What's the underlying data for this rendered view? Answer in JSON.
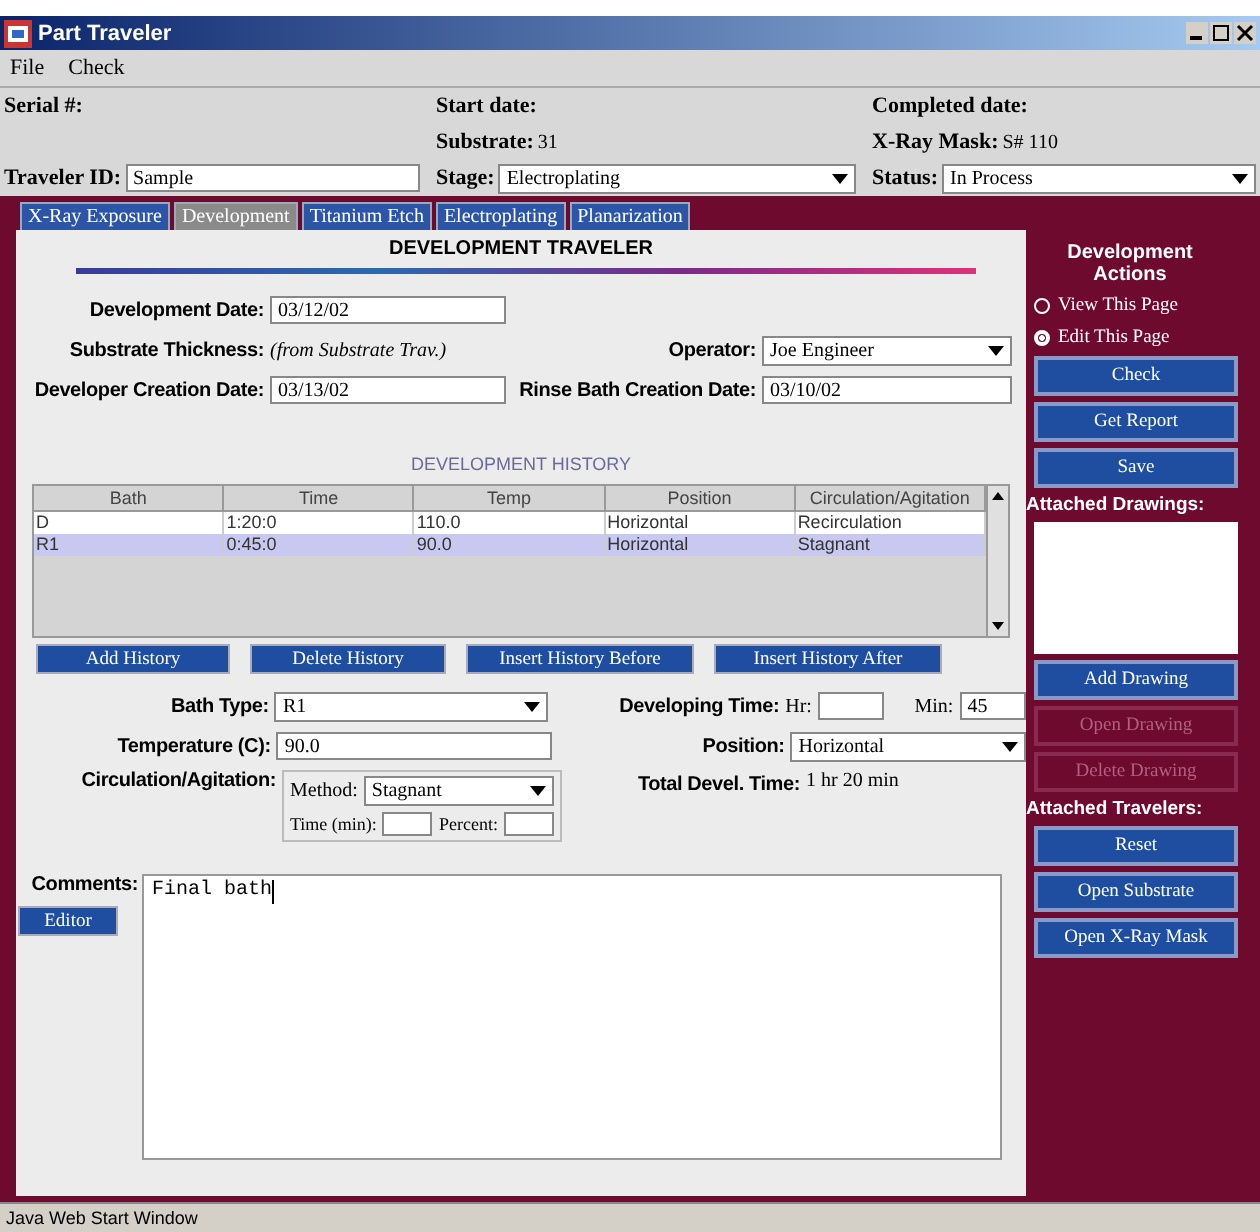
{
  "window": {
    "title": "Part Traveler"
  },
  "menu": [
    "File",
    "Check"
  ],
  "header": {
    "serial": {
      "label": "Serial #:"
    },
    "start_date": {
      "label": "Start date:"
    },
    "completed_date": {
      "label": "Completed date:"
    },
    "substrate": {
      "label": "Substrate:",
      "value": "31"
    },
    "xray_mask": {
      "label": "X-Ray Mask:",
      "value": "S# 110"
    },
    "traveler_id": {
      "label": "Traveler ID:",
      "value": "Sample"
    },
    "stage": {
      "label": "Stage:",
      "value": "Electroplating"
    },
    "status": {
      "label": "Status:",
      "value": "In Process"
    }
  },
  "tabs": [
    {
      "label": "X-Ray Exposure",
      "selected": false
    },
    {
      "label": "Development",
      "selected": true
    },
    {
      "label": "Titanium Etch",
      "selected": false
    },
    {
      "label": "Electroplating",
      "selected": false
    },
    {
      "label": "Planarization",
      "selected": false
    }
  ],
  "form": {
    "title": "DEVELOPMENT TRAVELER",
    "development_date": {
      "label": "Development Date:",
      "value": "03/12/02"
    },
    "substrate_thickness": {
      "label": "Substrate Thickness:",
      "value": "(from Substrate Trav.)"
    },
    "operator": {
      "label": "Operator:",
      "value": "Joe Engineer"
    },
    "developer_creation_date": {
      "label": "Developer Creation Date:",
      "value": "03/13/02"
    },
    "rinse_bath_creation_date": {
      "label": "Rinse Bath Creation Date:",
      "value": "03/10/02"
    }
  },
  "history": {
    "title": "DEVELOPMENT HISTORY",
    "columns": [
      "Bath",
      "Time",
      "Temp",
      "Position",
      "Circulation/Agitation"
    ],
    "rows": [
      {
        "cells": [
          "D",
          "1:20:0",
          "110.0",
          "Horizontal",
          "Recirculation"
        ],
        "selected": false
      },
      {
        "cells": [
          "R1",
          "0:45:0",
          "90.0",
          "Horizontal",
          "Stagnant"
        ],
        "selected": true
      }
    ],
    "buttons": [
      "Add History",
      "Delete History",
      "Insert History Before",
      "Insert History After"
    ]
  },
  "bath": {
    "bath_type": {
      "label": "Bath Type:",
      "value": "R1"
    },
    "developing_time": {
      "label": "Developing Time:",
      "hr_label": "Hr:",
      "min_label": "Min:",
      "min_value": "45"
    },
    "temperature": {
      "label": "Temperature (C):",
      "value": "90.0"
    },
    "position": {
      "label": "Position:",
      "value": "Horizontal"
    },
    "circulation": {
      "label": "Circulation/Agitation:",
      "method_label": "Method:",
      "method_value": "Stagnant",
      "time_label": "Time (min):",
      "percent_label": "Percent:"
    },
    "total_time": {
      "label": "Total Devel. Time:",
      "value": "1 hr 20 min"
    }
  },
  "comments": {
    "label": "Comments:",
    "editor_button": "Editor",
    "value": "Final bath"
  },
  "sidebar": {
    "title": "Development Actions",
    "radios": [
      {
        "label": "View This Page",
        "selected": false
      },
      {
        "label": "Edit This Page",
        "selected": true
      }
    ],
    "items": [
      {
        "kind": "button",
        "label": "Check",
        "disabled": false
      },
      {
        "kind": "button",
        "label": "Get Report",
        "disabled": false
      },
      {
        "kind": "button",
        "label": "Save",
        "disabled": false
      },
      {
        "kind": "heading",
        "label": "Attached Drawings:"
      },
      {
        "kind": "list"
      },
      {
        "kind": "button",
        "label": "Add Drawing",
        "disabled": false
      },
      {
        "kind": "button",
        "label": "Open Drawing",
        "disabled": true
      },
      {
        "kind": "button",
        "label": "Delete Drawing",
        "disabled": true
      },
      {
        "kind": "heading",
        "label": "Attached Travelers:"
      },
      {
        "kind": "button",
        "label": "Reset",
        "disabled": false
      },
      {
        "kind": "button",
        "label": "Open Substrate",
        "disabled": false
      },
      {
        "kind": "button",
        "label": "Open X-Ray Mask",
        "disabled": false
      }
    ]
  },
  "status_bar": "Java Web Start Window"
}
